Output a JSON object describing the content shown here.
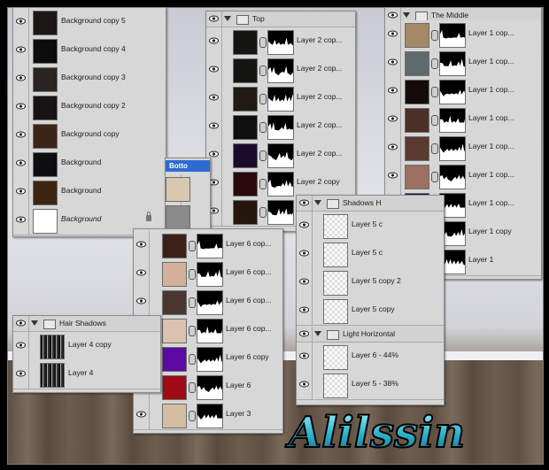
{
  "watermark": "Alilssin",
  "panelA": {
    "rows": [
      {
        "label": "Background copy 5",
        "color": "#1b1716"
      },
      {
        "label": "Background copy 4",
        "color": "#0d0c0c"
      },
      {
        "label": "Background copy 3",
        "color": "#2c2422"
      },
      {
        "label": "Background copy 2",
        "color": "#181414"
      },
      {
        "label": "Background copy",
        "color": "#3a2418"
      },
      {
        "label": "Background",
        "color": "#0e0e10"
      },
      {
        "label": "Background",
        "color": "#3b2512"
      },
      {
        "label": "Background",
        "color": "#ffffff",
        "italic": true,
        "lock": true
      }
    ]
  },
  "panelTop": {
    "group": "Top",
    "rows": [
      {
        "label": "Layer 2 cop...",
        "color": "#141410"
      },
      {
        "label": "Layer 2 cop...",
        "color": "#141413"
      },
      {
        "label": "Layer 2 cop...",
        "color": "#201a12"
      },
      {
        "label": "Layer 2 cop...",
        "color": "#0f0f0f"
      },
      {
        "label": "Layer 2 cop...",
        "color": "#1a0c2a"
      },
      {
        "label": "Layer 2 copy",
        "color": "#2a0a0a"
      },
      {
        "label": "",
        "color": "#24160c"
      }
    ]
  },
  "panelMiddle": {
    "group": "The Middle",
    "rows": [
      {
        "label": "Layer 1 cop...",
        "color": "#a58866"
      },
      {
        "label": "Layer 1 cop...",
        "color": "#5f6a6c"
      },
      {
        "label": "Layer 1 cop...",
        "color": "#140b0a"
      },
      {
        "label": "Layer 1 cop...",
        "color": "#4b3028"
      },
      {
        "label": "Layer 1 cop...",
        "color": "#5a3a2e"
      },
      {
        "label": "Layer 1 cop...",
        "color": "#9a7060"
      },
      {
        "label": "Layer 1 cop...",
        "color": "#2a0f60"
      },
      {
        "label": "Layer 1 copy",
        "color": "#5a0b10"
      },
      {
        "label": "Layer 1",
        "color": "#a58462"
      }
    ]
  },
  "panelBottom": {
    "tab": "Botto",
    "rows": [
      {
        "label": "",
        "color": "#d8c8ae"
      },
      {
        "label": "",
        "color": "#8a8a8a"
      }
    ]
  },
  "panelLayer6": {
    "rows": [
      {
        "label": "Layer 6 cop...",
        "color": "#3a2218"
      },
      {
        "label": "Layer 6 cop...",
        "color": "#d2b09a"
      },
      {
        "label": "Layer 6 cop...",
        "color": "#4a3630"
      },
      {
        "label": "Layer 6 cop...",
        "color": "#dcc0b0"
      },
      {
        "label": "Layer 6 copy",
        "color": "#5a0aa0"
      },
      {
        "label": "Layer 6",
        "color": "#a00a14"
      },
      {
        "label": "Layer 3",
        "color": "#d4bda0"
      }
    ]
  },
  "panelShadows": {
    "group": "Shadows H",
    "rows": [
      {
        "label": "Layer 5 c"
      },
      {
        "label": "Layer 5 c"
      },
      {
        "label": "Layer 5 copy 2"
      },
      {
        "label": "Layer 5 copy"
      }
    ],
    "group2": "Light Horizontal",
    "rows2": [
      {
        "label": "Layer 6 - 44%"
      },
      {
        "label": "Layer 5 - 38%"
      }
    ]
  },
  "panelHair": {
    "group": "Hair Shadows",
    "rows": [
      {
        "label": "Layer 4 copy"
      },
      {
        "label": "Layer 4"
      }
    ]
  }
}
